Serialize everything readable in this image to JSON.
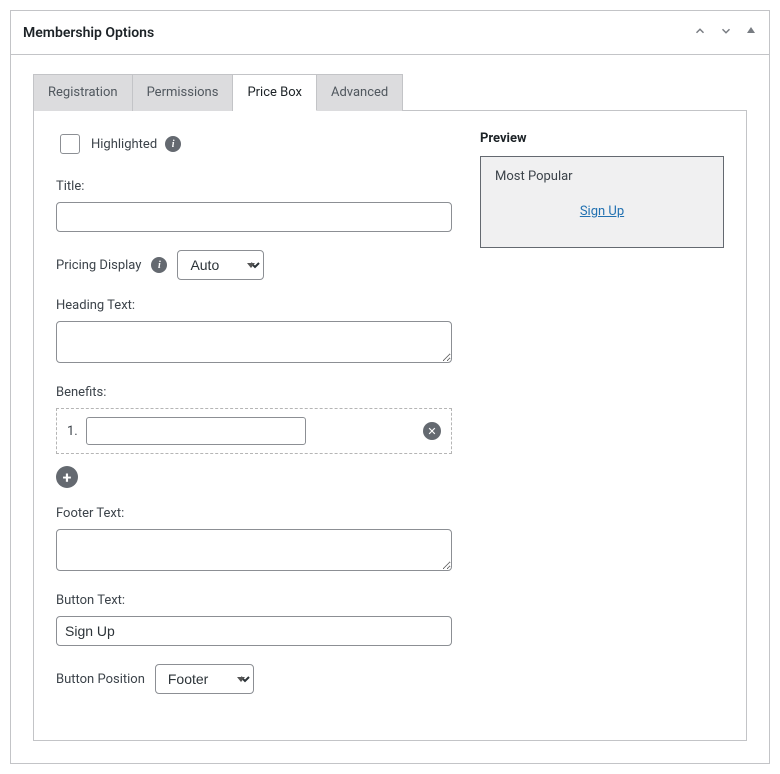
{
  "panel": {
    "title": "Membership Options"
  },
  "tabs": {
    "registration": "Registration",
    "permissions": "Permissions",
    "pricebox": "Price Box",
    "advanced": "Advanced"
  },
  "fields": {
    "highlighted_label": "Highlighted",
    "title_label": "Title:",
    "title_value": "",
    "pricing_display_label": "Pricing Display",
    "pricing_display_value": "Auto",
    "heading_text_label": "Heading Text:",
    "heading_text_value": "",
    "benefits_label": "Benefits:",
    "benefit_1_num": "1.",
    "benefit_1_value": "",
    "footer_text_label": "Footer Text:",
    "footer_text_value": "",
    "button_text_label": "Button Text:",
    "button_text_value": "Sign Up",
    "button_position_label": "Button Position",
    "button_position_value": "Footer"
  },
  "preview": {
    "heading": "Preview",
    "title": "Most Popular",
    "button": "Sign Up"
  }
}
